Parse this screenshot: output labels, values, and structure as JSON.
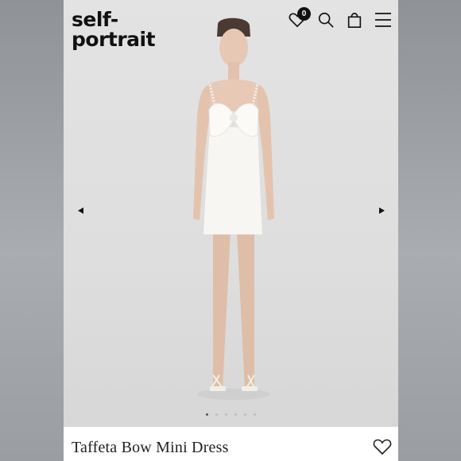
{
  "brand": {
    "line1": "self-",
    "line2": "portrait"
  },
  "header": {
    "wishlist_count": "0",
    "icons": [
      "heart-icon",
      "search-icon",
      "bag-icon",
      "menu-icon"
    ]
  },
  "gallery": {
    "slide_count": 6,
    "active_index": 0,
    "nav": [
      "prev-arrow",
      "next-arrow"
    ]
  },
  "product": {
    "title": "Taffeta Bow Mini Dress",
    "icon": "heart-outline-icon"
  },
  "colors": {
    "text": "#111111",
    "background": "#e3e3e3",
    "badge": "#111111"
  }
}
